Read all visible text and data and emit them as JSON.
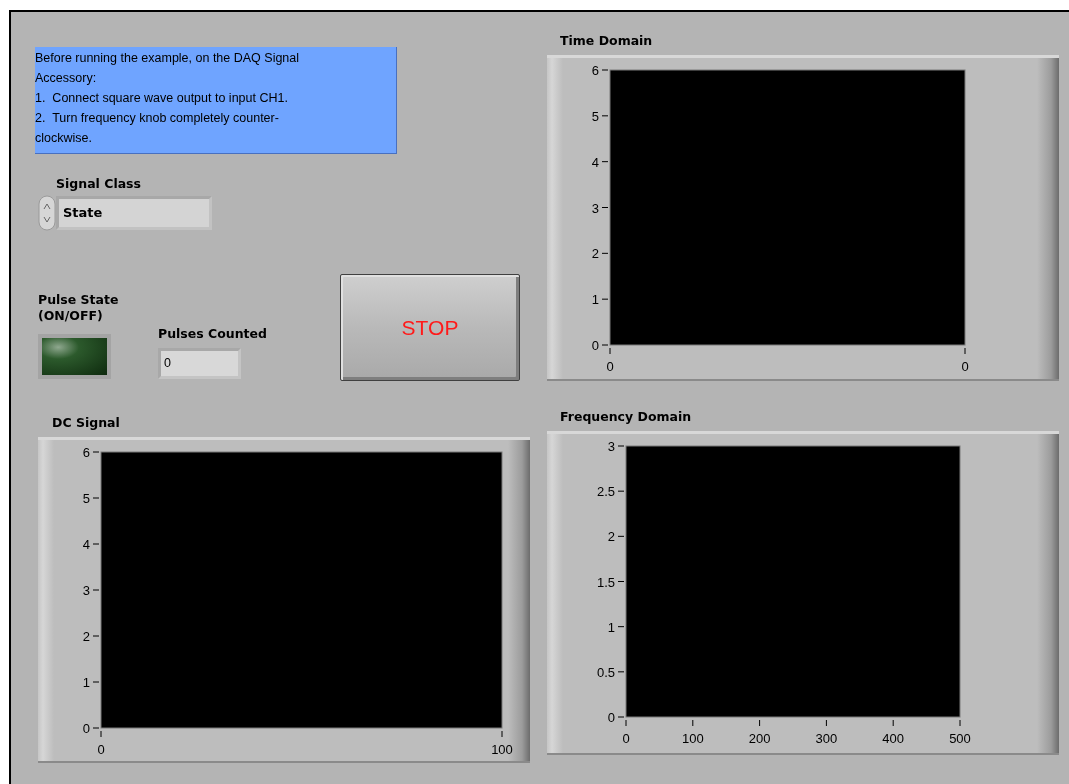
{
  "note": {
    "text": "Before running the example, on the DAQ Signal\nAccessory:\n1.  Connect square wave output to input CH1.\n2.  Turn frequency knob completely counter-\nclockwise."
  },
  "signal_class": {
    "label": "Signal Class",
    "value": "State"
  },
  "pulse_state": {
    "label": "Pulse State\n(ON/OFF)",
    "on": false
  },
  "pulses_counted": {
    "label": "Pulses Counted",
    "value": "0"
  },
  "stop_button": {
    "label": "STOP"
  },
  "graphs": [
    {
      "chart_data": {
        "type": "line",
        "title": "Time Domain",
        "categories": [
          "0",
          "0"
        ],
        "ylim": [
          0,
          6
        ],
        "yticks": [
          0,
          1,
          2,
          3,
          4,
          5,
          6
        ]
      }
    },
    {
      "chart_data": {
        "type": "line",
        "title": "DC Signal",
        "xlim": [
          0,
          100
        ],
        "ylim": [
          0,
          6
        ],
        "xticks": [
          0,
          100
        ],
        "yticks": [
          0,
          1,
          2,
          3,
          4,
          5,
          6
        ]
      }
    },
    {
      "chart_data": {
        "type": "line",
        "title": "Frequency Domain",
        "xlim": [
          0,
          500
        ],
        "ylim": [
          0,
          3
        ],
        "xticks": [
          0,
          100,
          200,
          300,
          400,
          500
        ],
        "yticks": [
          0,
          0.5,
          1,
          1.5,
          2,
          2.5,
          3
        ]
      }
    }
  ]
}
